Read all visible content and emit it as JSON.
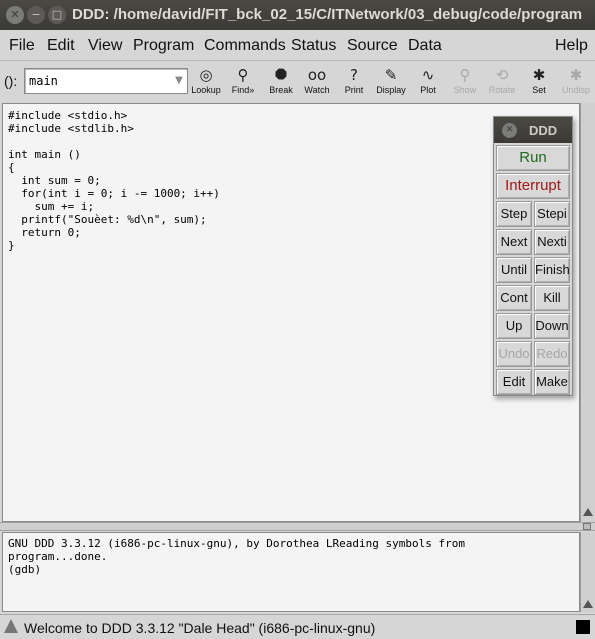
{
  "window": {
    "title": "DDD: /home/david/FIT_bck_02_15/C/ITNetwork/03_debug/code/program"
  },
  "menu": [
    "File",
    "Edit",
    "View",
    "Program",
    "Commands",
    "Status",
    "Source",
    "Data",
    "Help"
  ],
  "toolbar": {
    "arg_label": "():",
    "arg_value": "main",
    "tools": [
      {
        "label": "Lookup",
        "icon": "lookup-icon",
        "enabled": true
      },
      {
        "label": "Find»",
        "icon": "find-icon",
        "enabled": true
      },
      {
        "label": "Break",
        "icon": "stop-sign-icon",
        "enabled": true
      },
      {
        "label": "Watch",
        "icon": "glasses-icon",
        "enabled": true
      },
      {
        "label": "Print",
        "icon": "question-icon",
        "enabled": true
      },
      {
        "label": "Display",
        "icon": "display-icon",
        "enabled": true
      },
      {
        "label": "Plot",
        "icon": "plot-icon",
        "enabled": true
      },
      {
        "label": "Show",
        "icon": "magnifier-icon",
        "enabled": false
      },
      {
        "label": "Rotate",
        "icon": "rotate-icon",
        "enabled": false
      },
      {
        "label": "Set",
        "icon": "bug-icon",
        "enabled": true
      },
      {
        "label": "Undisp",
        "icon": "undisplay-icon",
        "enabled": false
      }
    ]
  },
  "source": {
    "lines": [
      "#include <stdio.h>",
      "#include <stdlib.h>",
      "",
      "int main ()",
      "{",
      "  int sum = 0;",
      "  for(int i = 0; i -= 1000; i++)",
      "    sum += i;",
      "  printf(\"Souèet: %d\\n\", sum);",
      "  return 0;",
      "}"
    ]
  },
  "console": {
    "lines": [
      "GNU DDD 3.3.12 (i686-pc-linux-gnu), by Dorothea LReading symbols from",
      "program...done.",
      "(gdb) "
    ]
  },
  "status": {
    "text": "Welcome to DDD 3.3.12 \"Dale Head\" (i686-pc-linux-gnu)"
  },
  "command_tool": {
    "title": "DDD",
    "run": "Run",
    "interrupt": "Interrupt",
    "interrupt_color": "#a01818",
    "run_color": "#1f6b1f",
    "buttons": [
      {
        "label": "Step",
        "enabled": true
      },
      {
        "label": "Stepi",
        "enabled": true
      },
      {
        "label": "Next",
        "enabled": true
      },
      {
        "label": "Nexti",
        "enabled": true
      },
      {
        "label": "Until",
        "enabled": true
      },
      {
        "label": "Finish",
        "enabled": true
      },
      {
        "label": "Cont",
        "enabled": true
      },
      {
        "label": "Kill",
        "enabled": true
      },
      {
        "label": "Up",
        "enabled": true
      },
      {
        "label": "Down",
        "enabled": true
      },
      {
        "label": "Undo",
        "enabled": false
      },
      {
        "label": "Redo",
        "enabled": false
      },
      {
        "label": "Edit",
        "enabled": true
      },
      {
        "label": "Make",
        "enabled": true
      }
    ]
  }
}
